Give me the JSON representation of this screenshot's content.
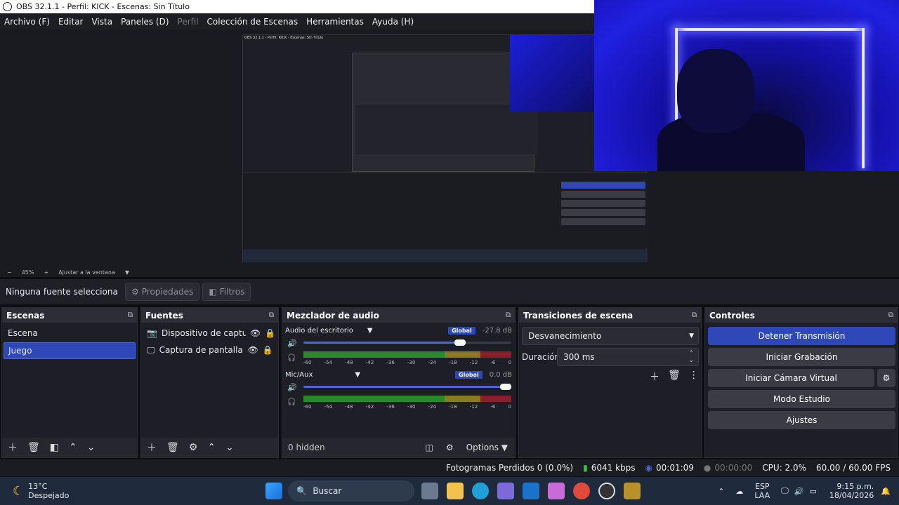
{
  "window": {
    "title": "OBS 32.1.1 - Perfil: KICK - Escenas: Sin Título"
  },
  "menu": [
    "Archivo (F)",
    "Editar",
    "Vista",
    "Paneles (D)",
    "Perfil",
    "Colección de Escenas",
    "Herramientas",
    "Ayuda (H)"
  ],
  "zoom": {
    "minus": "−",
    "value": "45%",
    "plus": "+",
    "fit_label": "Ajustar a la ventana"
  },
  "source_bar": {
    "selected_label": "Ninguna fuente selecciona",
    "properties": "Propiedades",
    "filters": "Filtros"
  },
  "scenes": {
    "title": "Escenas",
    "items": [
      {
        "label": "Escena",
        "selected": false
      },
      {
        "label": "Juego",
        "selected": true
      }
    ]
  },
  "sources": {
    "title": "Fuentes",
    "items": [
      {
        "label": "Dispositivo de captura d",
        "icon": "camera-icon"
      },
      {
        "label": "Captura de pantalla",
        "icon": "monitor-icon"
      }
    ]
  },
  "mixer": {
    "title": "Mezclador de audio",
    "channels": [
      {
        "name": "Audio del escritorio",
        "badge": "Global",
        "db": "-27.8 dB",
        "volume": 0.78
      },
      {
        "name": "Mic/Aux",
        "badge": "Global",
        "db": "0.0 dB",
        "volume": 1.0
      }
    ],
    "ticks": [
      "-60",
      "-54",
      "-48",
      "-42",
      "-36",
      "-30",
      "-24",
      "-18",
      "-12",
      "-6",
      "0"
    ],
    "hidden": "0 hidden",
    "options": "Options"
  },
  "transitions": {
    "title": "Transiciones de escena",
    "type": "Desvanecimiento",
    "duration_label": "Duración",
    "duration": "300 ms"
  },
  "controls": {
    "title": "Controles",
    "stop_stream": "Detener Transmisión",
    "start_record": "Iniciar Grabación",
    "start_vcam": "Iniciar Cámara Virtual",
    "studio_mode": "Modo Estudio",
    "settings": "Ajustes"
  },
  "status": {
    "dropped": "Fotogramas Perdidos 0 (0.0%)",
    "bitrate": "6041 kbps",
    "stream_time": "00:01:09",
    "rec_time": "00:00:00",
    "cpu": "CPU: 2.0%",
    "fps": "60.00 / 60.00 FPS"
  },
  "taskbar": {
    "weather_temp": "13°C",
    "weather_desc": "Despejado",
    "search": "Buscar",
    "lang1": "ESP",
    "lang2": "LAA",
    "time": "9:15 p.m.",
    "date": "18/04/2026"
  },
  "colors": {
    "accent": "#2f48b8",
    "meter_green": "#2a8a2a",
    "meter_yellow": "#8a7a20",
    "meter_red": "#8a1f2a"
  }
}
